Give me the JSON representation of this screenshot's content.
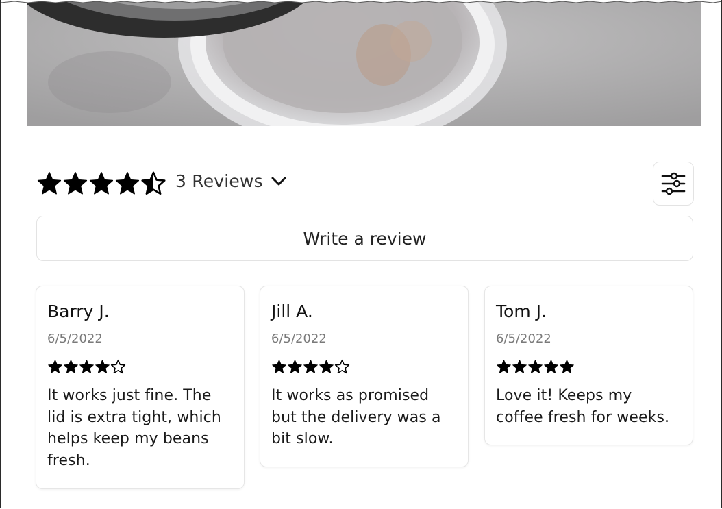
{
  "summary": {
    "rating": 4.5,
    "reviews_label": "3 Reviews"
  },
  "write_review_label": "Write a review",
  "reviews": [
    {
      "name": "Barry J.",
      "date": "6/5/2022",
      "rating": 4,
      "body": "It works just fine. The lid is extra tight, which helps keep my beans fresh."
    },
    {
      "name": "Jill A.",
      "date": "6/5/2022",
      "rating": 4,
      "body": "It works as promised but the delivery was a bit slow."
    },
    {
      "name": "Tom J.",
      "date": "6/5/2022",
      "rating": 5,
      "body": "Love it! Keeps my coffee fresh for weeks."
    }
  ],
  "icons": {
    "rating_star": "star-icon",
    "toggle": "chevron-down-icon",
    "filter": "sliders-icon"
  },
  "colors": {
    "star": "#000000",
    "border": "#e3e3e3",
    "muted_text": "#7a7a7a"
  }
}
